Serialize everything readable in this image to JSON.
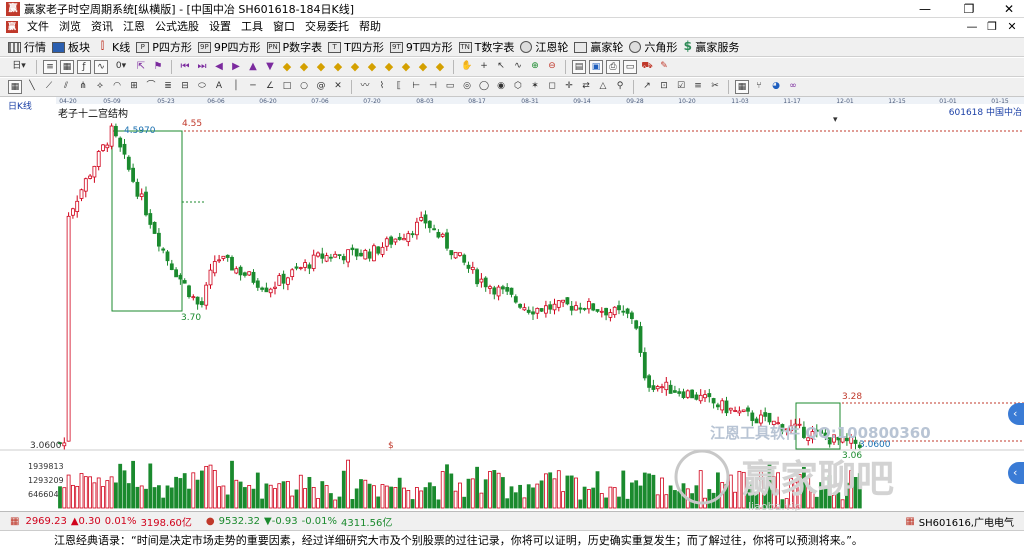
{
  "window": {
    "logo_char": "赢",
    "title": "赢家老子时空周期系统[纵横版] - [中国中冶  SH601618-184日K线]",
    "controls": [
      "—",
      "❐",
      "✕"
    ],
    "mdi_controls": [
      "—",
      "❐",
      "✕"
    ]
  },
  "menu": [
    "文件",
    "浏览",
    "资讯",
    "江恩",
    "公式选股",
    "设置",
    "工具",
    "窗口",
    "交易委托",
    "帮助"
  ],
  "toolbar1": [
    {
      "label": "行情",
      "icon": "grid-icon"
    },
    {
      "label": "板块",
      "icon": "block-icon"
    },
    {
      "label": "K线",
      "icon": "candlestick-icon"
    },
    {
      "label": "P四方形",
      "icon": "p-square-icon"
    },
    {
      "label": "9P四方形",
      "icon": "9p-square-icon"
    },
    {
      "label": "P数字表",
      "icon": "p-number-table-icon"
    },
    {
      "label": "T四方形",
      "icon": "t-square-icon"
    },
    {
      "label": "9T四方形",
      "icon": "9t-square-icon"
    },
    {
      "label": "T数字表",
      "icon": "t-number-table-icon"
    },
    {
      "label": "江恩轮",
      "icon": "gann-wheel-icon"
    },
    {
      "label": "赢家轮",
      "icon": "winner-wheel-icon"
    },
    {
      "label": "六角形",
      "icon": "hexagon-icon"
    },
    {
      "label": "赢家服务",
      "icon": "dollar-icon"
    }
  ],
  "toolbar2": {
    "dropdown1": "日",
    "dropdown2": "0"
  },
  "chart": {
    "period_label": "日K线",
    "stock_label": "601618 中国中冶",
    "structure_label": "老子十二宫结构",
    "date_ticks": [
      "04-20",
      "05-09",
      "05-23",
      "06-06",
      "06-20",
      "07-06",
      "07-20",
      "08-03",
      "08-17",
      "08-31",
      "09-14",
      "09-28",
      "10-20",
      "11-03",
      "11-17",
      "12-01",
      "12-15",
      "01-01",
      "01-15"
    ],
    "box1": {
      "high": "4.55",
      "high_close": "4.5970",
      "low": "3.70"
    },
    "box2": {
      "high": "3.28",
      "low_close": "3.0600",
      "low": "3.06"
    },
    "vol_top": "3.0600",
    "vol_marker": "$",
    "volume_ticks": [
      "1939813",
      "1293209",
      "646604"
    ],
    "watermark_line": "江恩工具软件 QQ:100800360",
    "watermark_brand": "赢家聊吧",
    "watermark_url": "liaoba.vip"
  },
  "colors": {
    "up": "#d0021b",
    "down": "#1b8a2e",
    "dash": "#c0392b",
    "box": "#1b8a2e",
    "axis_text": "#333333",
    "stock_label": "#1a3fa6"
  },
  "statusbar": {
    "index1_value": "2969.23",
    "index1_change": "▲0.30",
    "index1_pct": "0.01%",
    "index1_amount": "3198.60亿",
    "index2_value": "9532.32",
    "index2_change": "▼-0.93",
    "index2_pct": "-0.01%",
    "index2_amount": "4311.56亿",
    "right_stock": "SH601616,广电电气"
  },
  "quote": "江恩经典语录：“时间是决定市场走势的重要因素，经过详细研究大市及个别股票的过往记录，你将可以证明，历史确实重复发生；而了解过往，你将可以预测将来。”。",
  "chart_data": {
    "type": "candlestick",
    "period": "日K线",
    "x_ticks": [
      "04-20",
      "05-09",
      "05-23",
      "06-06",
      "06-20",
      "07-06",
      "07-20",
      "08-03",
      "08-17",
      "08-31",
      "09-14",
      "09-28",
      "10-20",
      "11-03",
      "11-17",
      "12-01",
      "12-15",
      "01-01",
      "01-15"
    ],
    "price_key_points": [
      {
        "date": "04-20",
        "close": 4.15
      },
      {
        "date": "05-09",
        "close": 4.55
      },
      {
        "date": "05-23",
        "close": 3.95
      },
      {
        "date": "06-02",
        "close": 3.7
      },
      {
        "date": "06-06",
        "close": 3.95
      },
      {
        "date": "06-20",
        "close": 3.8
      },
      {
        "date": "07-06",
        "close": 3.95
      },
      {
        "date": "07-20",
        "close": 3.97
      },
      {
        "date": "08-03",
        "close": 4.12
      },
      {
        "date": "08-17",
        "close": 3.85
      },
      {
        "date": "08-31",
        "close": 3.7
      },
      {
        "date": "09-14",
        "close": 3.72
      },
      {
        "date": "09-28",
        "close": 3.66
      },
      {
        "date": "10-02",
        "close": 3.35
      },
      {
        "date": "10-20",
        "close": 3.3
      },
      {
        "date": "11-03",
        "close": 3.2
      },
      {
        "date": "11-17",
        "close": 3.13
      },
      {
        "date": "12-01",
        "close": 3.06
      }
    ],
    "annotations": [
      "4.55",
      "4.5970",
      "3.70",
      "3.28",
      "3.0600",
      "3.06"
    ],
    "volume_ticks": [
      1939813,
      1293209,
      646604
    ]
  }
}
